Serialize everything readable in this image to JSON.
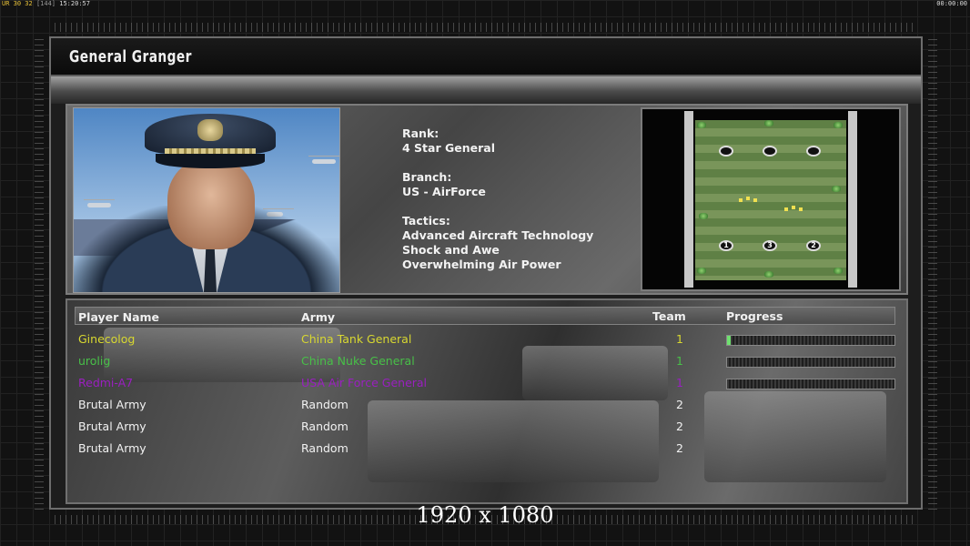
{
  "topbar": {
    "fps_prefix": "UR",
    "fps_values": "30 32",
    "fps_extra": "[144]",
    "clock": "15:20:57",
    "timer": "00:00:00"
  },
  "general": {
    "name": "General Granger",
    "rank_label": "Rank:",
    "rank": "4 Star General",
    "branch_label": "Branch:",
    "branch": "US - AirForce",
    "tactics_label": "Tactics:",
    "tactics": [
      "Advanced Aircraft Technology",
      "Shock and Awe",
      "Overwhelming Air Power"
    ]
  },
  "minimap": {
    "slots": [
      "",
      "",
      "",
      "1",
      "3",
      "2"
    ]
  },
  "players": {
    "headers": {
      "name": "Player Name",
      "army": "Army",
      "team": "Team",
      "progress": "Progress"
    },
    "rows": [
      {
        "name": "Ginecolog",
        "army": "China Tank General",
        "team": "1",
        "color": "#d8d830",
        "progress": 0.02,
        "show_progress": true
      },
      {
        "name": "urolig",
        "army": "China Nuke General",
        "team": "1",
        "color": "#48c048",
        "progress": 0.0,
        "show_progress": true
      },
      {
        "name": "Redmi-A7",
        "army": "USA Air Force General",
        "team": "1",
        "color": "#9a1fc0",
        "progress": 0.0,
        "show_progress": true
      },
      {
        "name": "Brutal Army",
        "army": "Random",
        "team": "2",
        "color": "#f2f2f2",
        "show_progress": false
      },
      {
        "name": "Brutal Army",
        "army": "Random",
        "team": "2",
        "color": "#f2f2f2",
        "show_progress": false
      },
      {
        "name": "Brutal Army",
        "army": "Random",
        "team": "2",
        "color": "#f2f2f2",
        "show_progress": false
      }
    ]
  },
  "overlay": {
    "resolution": "1920 x 1080"
  }
}
